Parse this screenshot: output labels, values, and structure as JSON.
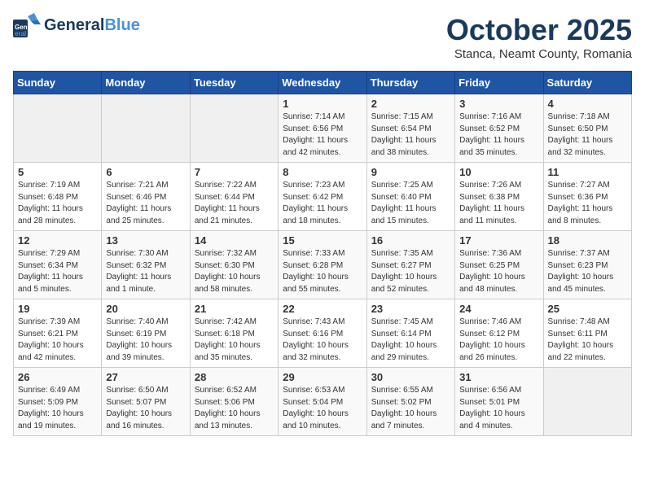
{
  "header": {
    "logo_line1": "General",
    "logo_line2": "Blue",
    "main_title": "October 2025",
    "subtitle": "Stanca, Neamt County, Romania"
  },
  "days_of_week": [
    "Sunday",
    "Monday",
    "Tuesday",
    "Wednesday",
    "Thursday",
    "Friday",
    "Saturday"
  ],
  "weeks": [
    [
      {
        "day": "",
        "info": ""
      },
      {
        "day": "",
        "info": ""
      },
      {
        "day": "",
        "info": ""
      },
      {
        "day": "1",
        "info": "Sunrise: 7:14 AM\nSunset: 6:56 PM\nDaylight: 11 hours\nand 42 minutes."
      },
      {
        "day": "2",
        "info": "Sunrise: 7:15 AM\nSunset: 6:54 PM\nDaylight: 11 hours\nand 38 minutes."
      },
      {
        "day": "3",
        "info": "Sunrise: 7:16 AM\nSunset: 6:52 PM\nDaylight: 11 hours\nand 35 minutes."
      },
      {
        "day": "4",
        "info": "Sunrise: 7:18 AM\nSunset: 6:50 PM\nDaylight: 11 hours\nand 32 minutes."
      }
    ],
    [
      {
        "day": "5",
        "info": "Sunrise: 7:19 AM\nSunset: 6:48 PM\nDaylight: 11 hours\nand 28 minutes."
      },
      {
        "day": "6",
        "info": "Sunrise: 7:21 AM\nSunset: 6:46 PM\nDaylight: 11 hours\nand 25 minutes."
      },
      {
        "day": "7",
        "info": "Sunrise: 7:22 AM\nSunset: 6:44 PM\nDaylight: 11 hours\nand 21 minutes."
      },
      {
        "day": "8",
        "info": "Sunrise: 7:23 AM\nSunset: 6:42 PM\nDaylight: 11 hours\nand 18 minutes."
      },
      {
        "day": "9",
        "info": "Sunrise: 7:25 AM\nSunset: 6:40 PM\nDaylight: 11 hours\nand 15 minutes."
      },
      {
        "day": "10",
        "info": "Sunrise: 7:26 AM\nSunset: 6:38 PM\nDaylight: 11 hours\nand 11 minutes."
      },
      {
        "day": "11",
        "info": "Sunrise: 7:27 AM\nSunset: 6:36 PM\nDaylight: 11 hours\nand 8 minutes."
      }
    ],
    [
      {
        "day": "12",
        "info": "Sunrise: 7:29 AM\nSunset: 6:34 PM\nDaylight: 11 hours\nand 5 minutes."
      },
      {
        "day": "13",
        "info": "Sunrise: 7:30 AM\nSunset: 6:32 PM\nDaylight: 11 hours\nand 1 minute."
      },
      {
        "day": "14",
        "info": "Sunrise: 7:32 AM\nSunset: 6:30 PM\nDaylight: 10 hours\nand 58 minutes."
      },
      {
        "day": "15",
        "info": "Sunrise: 7:33 AM\nSunset: 6:28 PM\nDaylight: 10 hours\nand 55 minutes."
      },
      {
        "day": "16",
        "info": "Sunrise: 7:35 AM\nSunset: 6:27 PM\nDaylight: 10 hours\nand 52 minutes."
      },
      {
        "day": "17",
        "info": "Sunrise: 7:36 AM\nSunset: 6:25 PM\nDaylight: 10 hours\nand 48 minutes."
      },
      {
        "day": "18",
        "info": "Sunrise: 7:37 AM\nSunset: 6:23 PM\nDaylight: 10 hours\nand 45 minutes."
      }
    ],
    [
      {
        "day": "19",
        "info": "Sunrise: 7:39 AM\nSunset: 6:21 PM\nDaylight: 10 hours\nand 42 minutes."
      },
      {
        "day": "20",
        "info": "Sunrise: 7:40 AM\nSunset: 6:19 PM\nDaylight: 10 hours\nand 39 minutes."
      },
      {
        "day": "21",
        "info": "Sunrise: 7:42 AM\nSunset: 6:18 PM\nDaylight: 10 hours\nand 35 minutes."
      },
      {
        "day": "22",
        "info": "Sunrise: 7:43 AM\nSunset: 6:16 PM\nDaylight: 10 hours\nand 32 minutes."
      },
      {
        "day": "23",
        "info": "Sunrise: 7:45 AM\nSunset: 6:14 PM\nDaylight: 10 hours\nand 29 minutes."
      },
      {
        "day": "24",
        "info": "Sunrise: 7:46 AM\nSunset: 6:12 PM\nDaylight: 10 hours\nand 26 minutes."
      },
      {
        "day": "25",
        "info": "Sunrise: 7:48 AM\nSunset: 6:11 PM\nDaylight: 10 hours\nand 22 minutes."
      }
    ],
    [
      {
        "day": "26",
        "info": "Sunrise: 6:49 AM\nSunset: 5:09 PM\nDaylight: 10 hours\nand 19 minutes."
      },
      {
        "day": "27",
        "info": "Sunrise: 6:50 AM\nSunset: 5:07 PM\nDaylight: 10 hours\nand 16 minutes."
      },
      {
        "day": "28",
        "info": "Sunrise: 6:52 AM\nSunset: 5:06 PM\nDaylight: 10 hours\nand 13 minutes."
      },
      {
        "day": "29",
        "info": "Sunrise: 6:53 AM\nSunset: 5:04 PM\nDaylight: 10 hours\nand 10 minutes."
      },
      {
        "day": "30",
        "info": "Sunrise: 6:55 AM\nSunset: 5:02 PM\nDaylight: 10 hours\nand 7 minutes."
      },
      {
        "day": "31",
        "info": "Sunrise: 6:56 AM\nSunset: 5:01 PM\nDaylight: 10 hours\nand 4 minutes."
      },
      {
        "day": "",
        "info": ""
      }
    ]
  ]
}
